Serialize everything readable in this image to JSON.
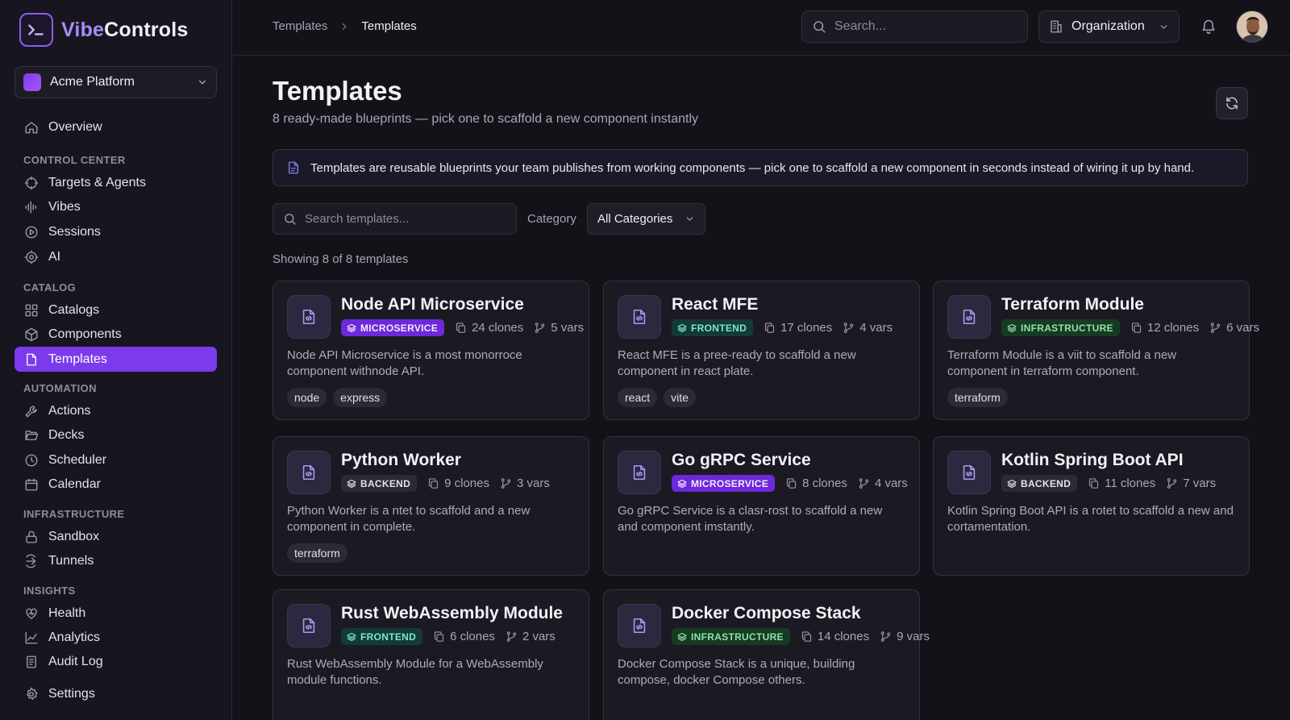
{
  "brand": {
    "name_accent": "Vibe",
    "name_rest": "Controls",
    "accent_color": "#8b5cf6"
  },
  "workspace": {
    "name": "Acme Platform"
  },
  "sidebar": {
    "overview": "Overview",
    "sections": {
      "control_center": "CONTROL CENTER",
      "catalog": "CATALOG",
      "automation": "AUTOMATION",
      "infrastructure": "INFRASTRUCTURE",
      "insights": "INSIGHTS"
    },
    "control_center": [
      "Targets & Agents",
      "Vibes",
      "Sessions",
      "AI"
    ],
    "catalog": [
      "Catalogs",
      "Components",
      "Templates"
    ],
    "automation": [
      "Actions",
      "Decks",
      "Scheduler",
      "Calendar"
    ],
    "infrastructure": [
      "Sandbox",
      "Tunnels"
    ],
    "insights": [
      "Health",
      "Analytics",
      "Audit Log"
    ],
    "settings": "Settings",
    "active_item": "Templates"
  },
  "topbar": {
    "breadcrumb": [
      "Templates",
      "Templates"
    ],
    "search_placeholder": "Search...",
    "org_label": "Organization"
  },
  "page": {
    "title": "Templates",
    "subtitle": "8 ready-made blueprints — pick one to scaffold a new component instantly",
    "info": "Templates are reusable blueprints your team publishes from working components — pick one to scaffold a new component in seconds instead of wiring it up by hand."
  },
  "filters": {
    "search_placeholder": "Search templates...",
    "category_label": "Category",
    "category_value": "All Categories",
    "showing": "Showing 8 of 8 templates"
  },
  "templates": [
    {
      "title": "Node API Microservice",
      "badge": "MICROSERVICE",
      "kind": "microservice",
      "clones": "24 clones",
      "vars": "5 vars",
      "desc": "Node API Microservice is a most monorroce component withnode API.",
      "tags": [
        "node",
        "express"
      ]
    },
    {
      "title": "React MFE",
      "badge": "FRONTEND",
      "kind": "frontend",
      "clones": "17 clones",
      "vars": "4 vars",
      "desc": "React MFE is a pree-ready to scaffold a new component in react plate.",
      "tags": [
        "react",
        "vite"
      ]
    },
    {
      "title": "Terraform Module",
      "badge": "INFRASTRUCTURE",
      "kind": "infrastructure",
      "clones": "12 clones",
      "vars": "6 vars",
      "desc": "Terraform Module is a viit to scaffold a new component in terraform component.",
      "tags": [
        "terraform"
      ]
    },
    {
      "title": "Python Worker",
      "badge": "BACKEND",
      "kind": "backend",
      "clones": "9 clones",
      "vars": "3 vars",
      "desc": "Python Worker is a ntet to scaffold and a new component in complete.",
      "tags": [
        "terraform"
      ]
    },
    {
      "title": "Go gRPC Service",
      "badge": "MICROSERVICE",
      "kind": "microservice",
      "clones": "8 clones",
      "vars": "4 vars",
      "desc": "Go gRPC Service is a clasr-rost to scaffold a new and component imstantly.",
      "tags": []
    },
    {
      "title": "Kotlin Spring Boot API",
      "badge": "BACKEND",
      "kind": "backend",
      "clones": "11 clones",
      "vars": "7 vars",
      "desc": "Kotlin Spring Boot API is a rotet to scaffold a new and cortamentation.",
      "tags": []
    },
    {
      "title": "Rust WebAssembly Module",
      "badge": "FRONTEND",
      "kind": "frontend",
      "clones": "6 clones",
      "vars": "2 vars",
      "desc": "Rust WebAssembly Module for a WebAssembly module functions.",
      "tags": []
    },
    {
      "title": "Docker Compose Stack",
      "badge": "INFRASTRUCTURE",
      "kind": "infrastructure",
      "clones": "14 clones",
      "vars": "9 vars",
      "desc": "Docker Compose Stack is a unique, building compose,  docker Compose others.",
      "tags": []
    }
  ]
}
